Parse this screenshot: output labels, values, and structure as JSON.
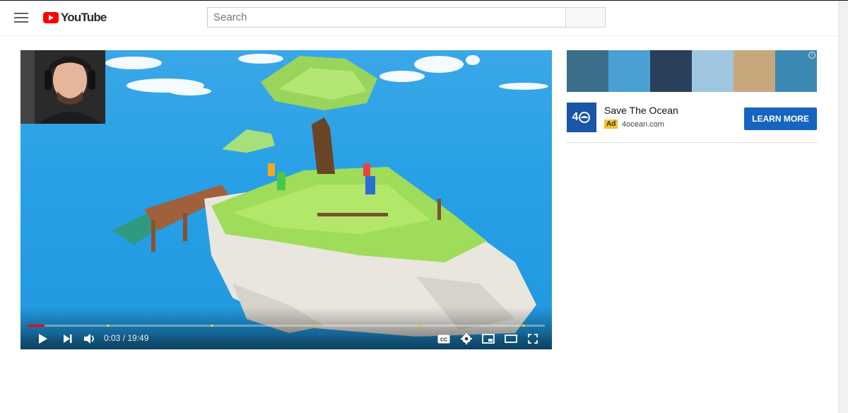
{
  "header": {
    "logo_text": "YouTube",
    "search_placeholder": "Search"
  },
  "player": {
    "time_display": "0:03 / 19:49",
    "progress_fraction": 0.0025,
    "controls": [
      "play-icon",
      "next-icon",
      "volume-icon",
      "cc-icon",
      "gear-icon",
      "miniplayer-icon",
      "theater-icon",
      "fullscreen-icon"
    ]
  },
  "ad": {
    "title": "Save The Ocean",
    "badge": "Ad",
    "domain": "4ocean.com",
    "cta_label": "LEARN MORE",
    "logo_text": "4",
    "accent_color": "#1565c0"
  }
}
